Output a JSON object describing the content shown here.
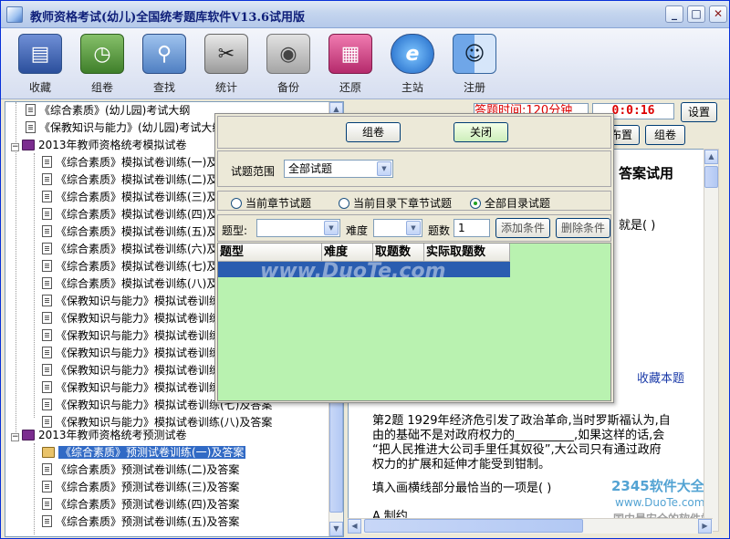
{
  "window": {
    "title": "教师资格考试(幼儿)全国统考题库软件V13.6试用版",
    "controls": [
      "_",
      "□",
      "✕"
    ]
  },
  "toolbar": {
    "items": [
      {
        "label": "收藏",
        "icon": "book-stack-icon",
        "glyph": "▤"
      },
      {
        "label": "组卷",
        "icon": "clock-doc-icon",
        "glyph": "◷"
      },
      {
        "label": "查找",
        "icon": "magnifier-icon",
        "glyph": "⚲"
      },
      {
        "label": "统计",
        "icon": "scissors-icon",
        "glyph": "✂"
      },
      {
        "label": "备份",
        "icon": "disk-icon",
        "glyph": "◉"
      },
      {
        "label": "还原",
        "icon": "books-icon",
        "glyph": "▦"
      },
      {
        "label": "主站",
        "icon": "ie-icon",
        "glyph": "e"
      },
      {
        "label": "注册",
        "icon": "finder-icon",
        "glyph": "☺"
      }
    ]
  },
  "tree": {
    "nodes": [
      {
        "text": "《综合素质》(幼儿园)考试大纲",
        "level": 1,
        "type": "doc"
      },
      {
        "text": "《保教知识与能力》(幼儿园)考试大纲",
        "level": 1,
        "type": "doc"
      },
      {
        "text": "2013年教师资格统考模拟试卷",
        "level": 0,
        "type": "book"
      },
      {
        "text": "《综合素质》模拟试卷训练(一)及答案",
        "level": 1,
        "type": "doc"
      },
      {
        "text": "《综合素质》模拟试卷训练(二)及答案",
        "level": 1,
        "type": "doc"
      },
      {
        "text": "《综合素质》模拟试卷训练(三)及答案",
        "level": 1,
        "type": "doc"
      },
      {
        "text": "《综合素质》模拟试卷训练(四)及答案",
        "level": 1,
        "type": "doc"
      },
      {
        "text": "《综合素质》模拟试卷训练(五)及答案",
        "level": 1,
        "type": "doc"
      },
      {
        "text": "《综合素质》模拟试卷训练(六)及答案",
        "level": 1,
        "type": "doc"
      },
      {
        "text": "《综合素质》模拟试卷训练(七)及答案",
        "level": 1,
        "type": "doc"
      },
      {
        "text": "《综合素质》模拟试卷训练(八)及答案",
        "level": 1,
        "type": "doc"
      },
      {
        "text": "《保教知识与能力》模拟试卷训练(一)及答案",
        "level": 1,
        "type": "doc"
      },
      {
        "text": "《保教知识与能力》模拟试卷训练(二)及答案",
        "level": 1,
        "type": "doc"
      },
      {
        "text": "《保教知识与能力》模拟试卷训练(三)及答案",
        "level": 1,
        "type": "doc"
      },
      {
        "text": "《保教知识与能力》模拟试卷训练(四)及答案",
        "level": 1,
        "type": "doc"
      },
      {
        "text": "《保教知识与能力》模拟试卷训练(五)及答案",
        "level": 1,
        "type": "doc"
      },
      {
        "text": "《保教知识与能力》模拟试卷训练(六)及答案",
        "level": 1,
        "type": "doc"
      },
      {
        "text": "《保教知识与能力》模拟试卷训练(七)及答案",
        "level": 1,
        "type": "doc"
      },
      {
        "text": "《保教知识与能力》模拟试卷训练(八)及答案",
        "level": 1,
        "type": "doc"
      },
      {
        "text": "2013年教师资格统考预测试卷",
        "level": 0,
        "type": "book"
      },
      {
        "text": "《综合素质》预测试卷训练(一)及答案",
        "level": 1,
        "type": "doc-open",
        "selected": true
      },
      {
        "text": "《综合素质》预测试卷训练(二)及答案",
        "level": 1,
        "type": "doc"
      },
      {
        "text": "《综合素质》预测试卷训练(三)及答案",
        "level": 1,
        "type": "doc"
      },
      {
        "text": "《综合素质》预测试卷训练(四)及答案",
        "level": 1,
        "type": "doc"
      },
      {
        "text": "《综合素质》预测试卷训练(五)及答案",
        "level": 1,
        "type": "doc"
      }
    ]
  },
  "exam": {
    "timer_label": "答题时间:120分钟",
    "timer_value": "0:0:16",
    "settings_label": "设置",
    "btn_layout": "布置",
    "btn_compose": "组卷",
    "answer_heading": "答案试用",
    "question_fragment": "就是( )",
    "collect_link": "收藏本题",
    "q2_line1": "第2题  1929年经济危引发了政治革命,当时罗斯福认为,自",
    "q2_line2": "由的基础不是对政府权力的__________,如果这样的话,会",
    "q2_line3": "“把人民推进大公司手里任其奴役”,大公司只有通过政府",
    "q2_line4": "权力的扩展和延伸才能受到钳制。",
    "q2_prompt": "填入画横线部分最恰当的一项是( )",
    "q2_option": "A.制约"
  },
  "dialog": {
    "btn_compose": "组卷",
    "btn_close": "关闭",
    "range_label": "试题范围",
    "range_value": "全部试题",
    "radios": [
      {
        "label": "当前章节试题",
        "checked": false
      },
      {
        "label": "当前目录下章节试题",
        "checked": false
      },
      {
        "label": "全部目录试题",
        "checked": true
      }
    ],
    "type_label": "题型:",
    "type_value": "",
    "difficulty_label": "难度",
    "difficulty_value": "",
    "count_label": "题数",
    "count_value": "1",
    "btn_add": "添加条件",
    "btn_delete": "删除条件",
    "columns": [
      "题型",
      "难度",
      "取题数",
      "实际取题数"
    ]
  },
  "watermarks": {
    "duote": "www.DuoTe.com",
    "bottom_site": "www.DuoTe.com",
    "brand": "2345软件大全",
    "slogan": "国内最安全的软件站"
  }
}
